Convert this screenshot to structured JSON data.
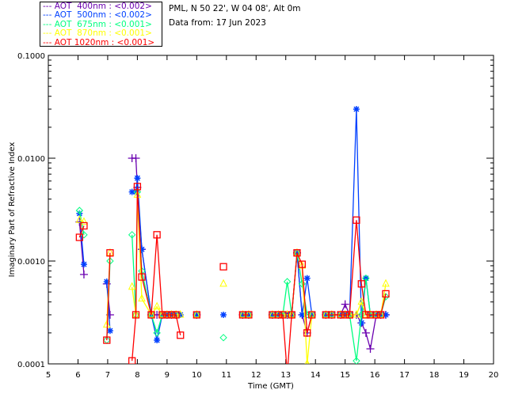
{
  "header": {
    "site": "PML, N 50 22', W 04 08', Alt 0m",
    "date": "Data from: 17 Jun 2023"
  },
  "chart_data": {
    "type": "line",
    "title": "",
    "xlabel": "Time (GMT)",
    "ylabel": "Imaginary Part of Refractive Index",
    "xlim": [
      5,
      20
    ],
    "ylim": [
      0.0001,
      0.1
    ],
    "yscale": "log",
    "xticks": [
      "5",
      "6",
      "7",
      "8",
      "9",
      "10",
      "11",
      "12",
      "13",
      "14",
      "15",
      "16",
      "17",
      "18",
      "19",
      "20"
    ],
    "yticks": [
      "0.0001",
      "0.0010",
      "0.0100",
      "0.1000"
    ],
    "grid": false,
    "legend_placement": "top-left, outside",
    "x": [
      6.05,
      6.2,
      6.97,
      7.08,
      7.82,
      7.95,
      8.0,
      8.15,
      8.47,
      8.66,
      8.84,
      9.0,
      9.15,
      9.3,
      9.45,
      10.0,
      10.9,
      11.55,
      11.75,
      12.55,
      12.75,
      12.9,
      13.05,
      13.2,
      13.38,
      13.55,
      13.72,
      13.88,
      14.35,
      14.55,
      14.85,
      15.0,
      15.15,
      15.38,
      15.55,
      15.7,
      15.85,
      16.05,
      16.2,
      16.37
    ],
    "series": [
      {
        "name": "AOT  400nm : <0.002>",
        "color": "#6a00b0",
        "marker": "plus",
        "values": [
          0.0024,
          0.00074,
          0.0006,
          0.0003,
          0.01,
          0.01,
          0.0052,
          0.0013,
          0.0003,
          0.0003,
          0.0003,
          0.0003,
          0.0003,
          0.0003,
          null,
          0.0003,
          null,
          0.0003,
          0.0003,
          0.0003,
          0.0003,
          0.0003,
          0.0003,
          0.0003,
          0.0012,
          0.0003,
          0.0002,
          0.0003,
          0.0003,
          0.0003,
          0.0003,
          0.00038,
          0.0003,
          0.0003,
          0.00025,
          0.0002,
          0.00014,
          0.0003,
          0.0003,
          0.0003
        ]
      },
      {
        "name": "AOT  500nm : <0.002>",
        "color": "#0040ff",
        "marker": "asterisk",
        "values": [
          0.0029,
          0.00093,
          0.00063,
          0.00021,
          0.0047,
          0.0047,
          0.0064,
          0.0013,
          0.0003,
          0.00017,
          0.0003,
          0.0003,
          0.0003,
          0.0003,
          0.0003,
          0.0003,
          0.0003,
          0.0003,
          0.0003,
          0.0003,
          0.0003,
          0.0003,
          0.0003,
          0.0003,
          0.0012,
          0.0003,
          0.00068,
          0.0003,
          0.0003,
          0.0003,
          0.0003,
          0.0003,
          0.0003,
          0.03,
          0.00025,
          0.00068,
          0.0003,
          0.0003,
          0.0003,
          0.0003
        ]
      },
      {
        "name": "AOT  675nm : <0.001>",
        "color": "#00ff80",
        "marker": "diamond",
        "values": [
          0.0031,
          0.0018,
          0.00017,
          0.001,
          0.0018,
          0.0003,
          0.0047,
          0.0008,
          0.0003,
          0.0002,
          0.0003,
          0.0003,
          0.0003,
          0.0003,
          null,
          0.0003,
          0.00018,
          0.0003,
          0.0003,
          0.0003,
          0.0003,
          0.0003,
          0.00063,
          0.0003,
          0.0012,
          0.0006,
          0.0003,
          0.0003,
          0.0003,
          0.0003,
          0.0003,
          0.0003,
          0.0003,
          0.000107,
          0.0003,
          0.00068,
          0.0003,
          0.0003,
          0.0003,
          0.00045
        ]
      },
      {
        "name": "AOT  870nm : <0.001>",
        "color": "#ffff00",
        "marker": "triangle",
        "values": [
          0.0025,
          0.0024,
          0.00024,
          0.0012,
          0.00056,
          0.0003,
          0.0044,
          0.00043,
          0.0003,
          0.00036,
          0.0003,
          0.0003,
          0.0003,
          0.0003,
          0.0003,
          0.0003,
          0.0006,
          0.0003,
          0.0003,
          0.0003,
          0.0003,
          0.0003,
          0.0003,
          0.0003,
          0.0012,
          0.0009,
          0.0001,
          0.0003,
          0.0003,
          0.0003,
          0.0003,
          0.0003,
          0.0003,
          0.0003,
          0.0004,
          0.0003,
          0.0003,
          0.0003,
          0.0003,
          0.0006
        ]
      },
      {
        "name": "AOT 1020nm : <0.001>",
        "color": "#ff0000",
        "marker": "square",
        "values": [
          0.0017,
          0.0022,
          0.00017,
          0.0012,
          0.000107,
          0.0003,
          0.0053,
          0.0007,
          0.0003,
          0.0018,
          0.0003,
          0.0003,
          0.0003,
          0.0003,
          0.00019,
          0.0003,
          0.00088,
          0.0003,
          0.0003,
          0.0003,
          0.0003,
          0.0003,
          8e-05,
          0.0003,
          0.0012,
          0.00093,
          0.0002,
          0.0003,
          0.0003,
          0.0003,
          0.0003,
          0.0003,
          0.0003,
          0.0025,
          0.0006,
          0.0003,
          0.0003,
          0.0003,
          0.0003,
          0.00048
        ]
      }
    ]
  }
}
